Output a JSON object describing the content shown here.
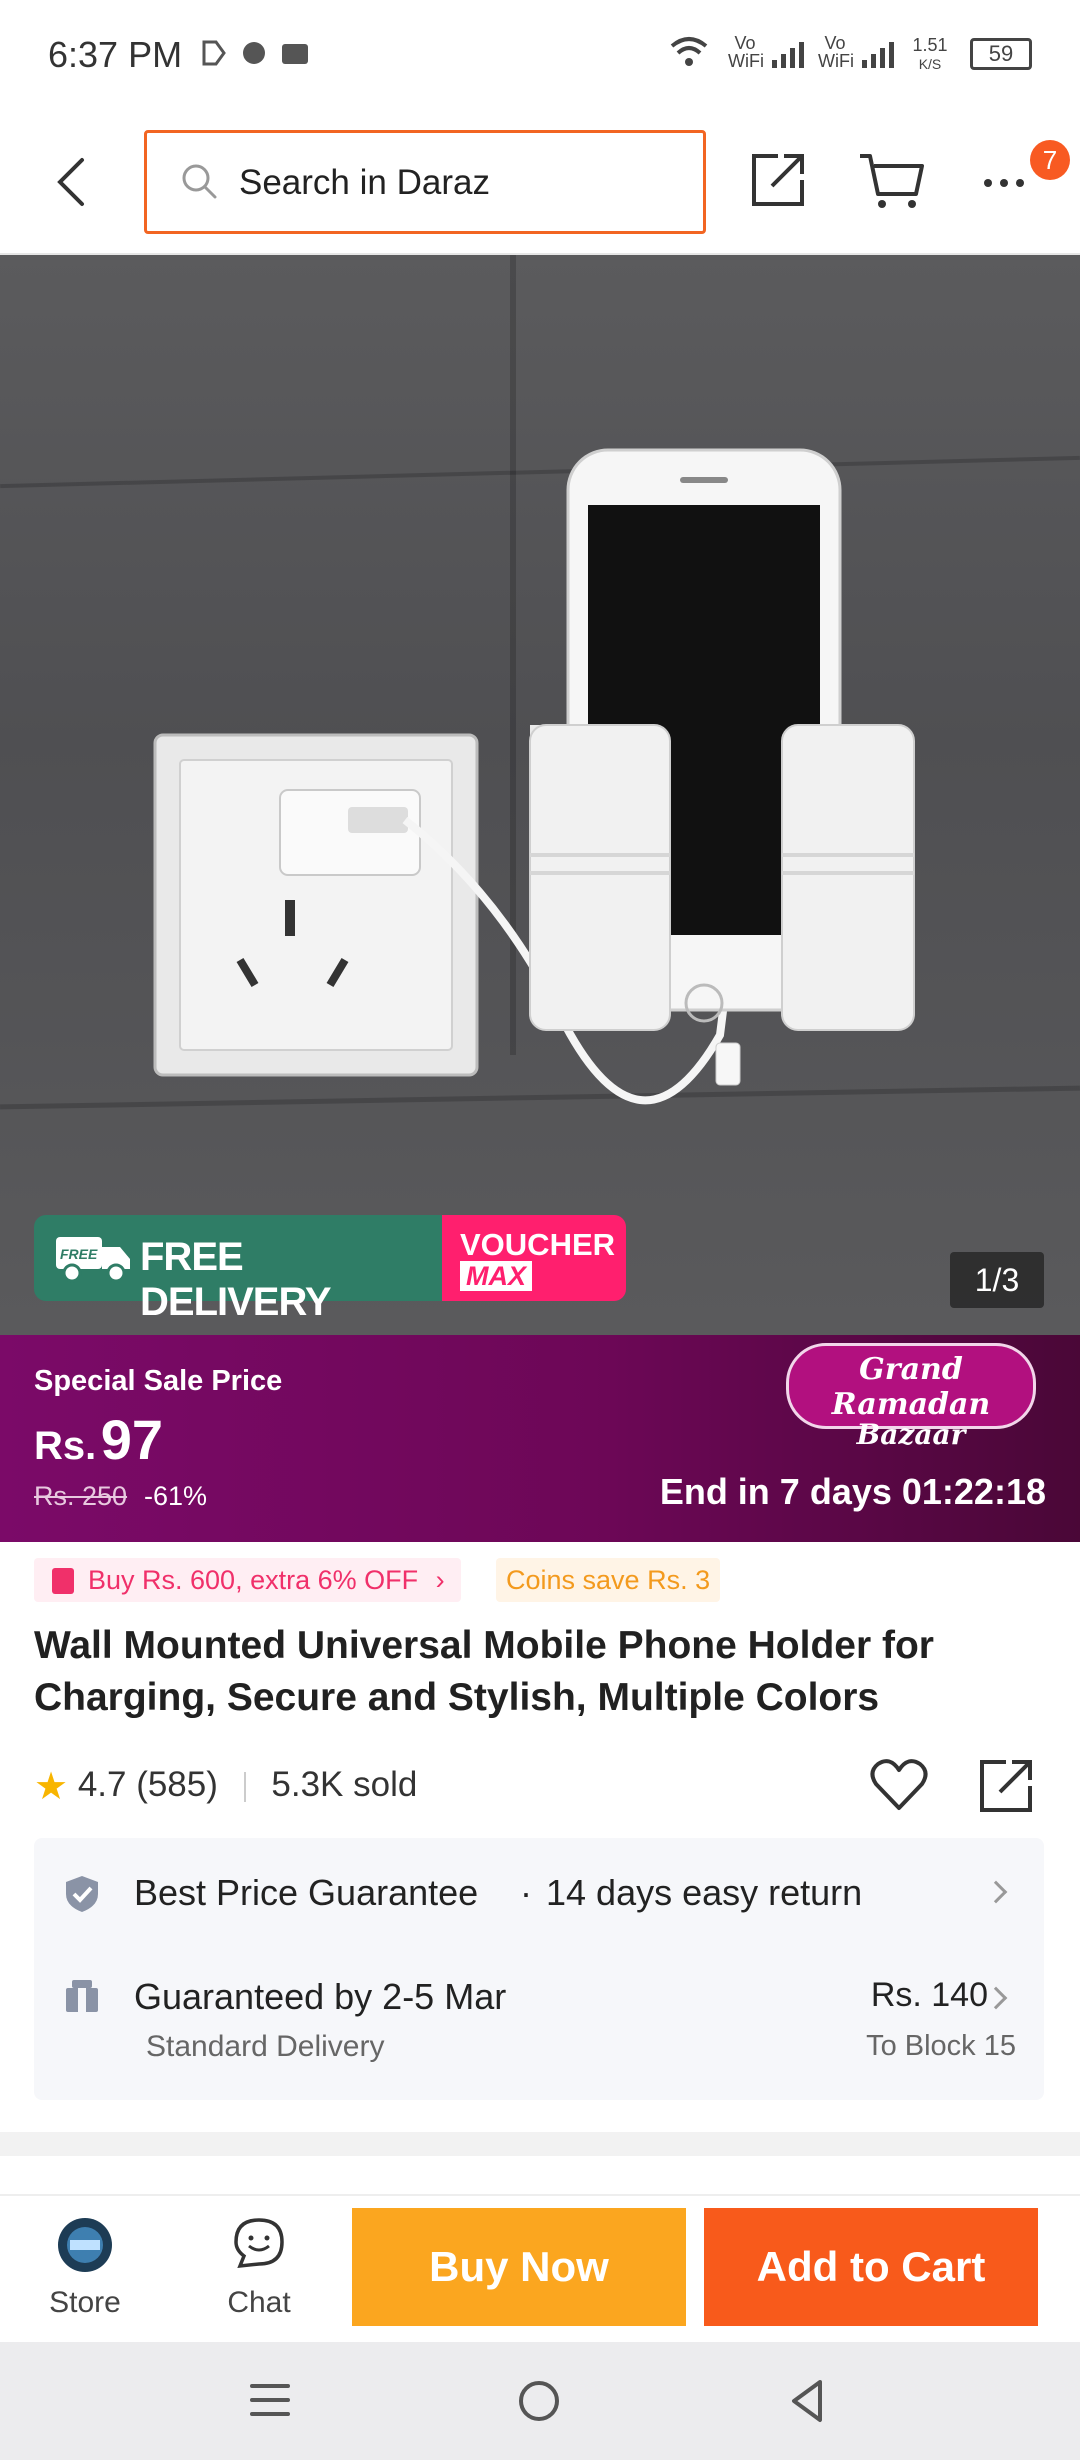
{
  "status_bar": {
    "time": "6:37 PM",
    "net1": "Vo WiFi",
    "net2": "Vo WiFi",
    "speed": "1.51",
    "speed_unit": "K/S",
    "battery": "59"
  },
  "top_bar": {
    "search_placeholder": "Search in Daraz",
    "menu_badge": "7"
  },
  "hero": {
    "badge_free_delivery": "FREE DELIVERY",
    "badge_free_icon": "FREE",
    "badge_voucher": "VOUCHER",
    "badge_max": "MAX",
    "image_counter": "1/3"
  },
  "sale": {
    "label": "Special Sale Price",
    "currency": "Rs.",
    "price": "97",
    "original_price": "Rs. 250",
    "discount": "-61%",
    "ends": "End in 7 days 01:22:18",
    "event_line1": "Grand Ramadan",
    "event_line2": "Bazaar",
    "colors": {
      "start": "#7b0a68",
      "end": "#4a0737"
    }
  },
  "promos": {
    "voucher_chip": "Buy Rs. 600, extra 6% OFF",
    "coins_chip": "Coins save Rs. 3"
  },
  "product": {
    "title": "Wall Mounted Universal Mobile Phone Holder for Charging, Secure and Stylish, Multiple Colors",
    "rating": "4.7 (585)",
    "sold": "5.3K sold"
  },
  "info": {
    "guarantee": "Best Price Guarantee",
    "return": "14 days easy return",
    "delivery_title": "Guaranteed by 2-5 Mar",
    "delivery_type": "Standard Delivery",
    "delivery_fee": "Rs. 140",
    "delivery_location": "To Block 15"
  },
  "action_bar": {
    "store_label": "Store",
    "chat_label": "Chat",
    "buy_now": "Buy Now",
    "add_to_cart": "Add to Cart",
    "colors": {
      "buy": "#fba61f",
      "cart": "#f85a1b"
    }
  },
  "accent_color": "#f26522"
}
